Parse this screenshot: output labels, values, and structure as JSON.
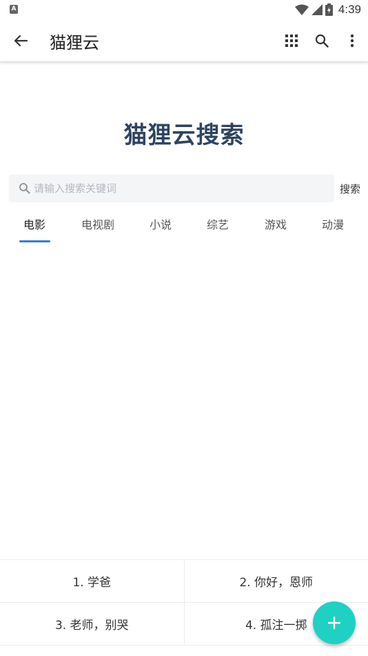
{
  "status_bar": {
    "time": "4:39",
    "indicator": "A"
  },
  "app_bar": {
    "title": "猫狸云"
  },
  "headline": "猫狸云搜索",
  "search": {
    "placeholder": "请输入搜索关键词",
    "value": "",
    "button_label": "搜索"
  },
  "tabs": [
    {
      "label": "电影",
      "active": true
    },
    {
      "label": "电视剧",
      "active": false
    },
    {
      "label": "小说",
      "active": false
    },
    {
      "label": "综艺",
      "active": false
    },
    {
      "label": "游戏",
      "active": false
    },
    {
      "label": "动漫",
      "active": false
    }
  ],
  "hot_list": [
    "1. 学爸",
    "2. 你好，恩师",
    "3. 老师，别哭",
    "4. 孤注一掷"
  ],
  "colors": {
    "accent": "#2f7ed8",
    "headline": "#2e4460",
    "fab": "#1fd1c2"
  },
  "icons": [
    "back-arrow-icon",
    "apps-grid-icon",
    "search-icon",
    "more-vert-icon",
    "add-icon"
  ]
}
